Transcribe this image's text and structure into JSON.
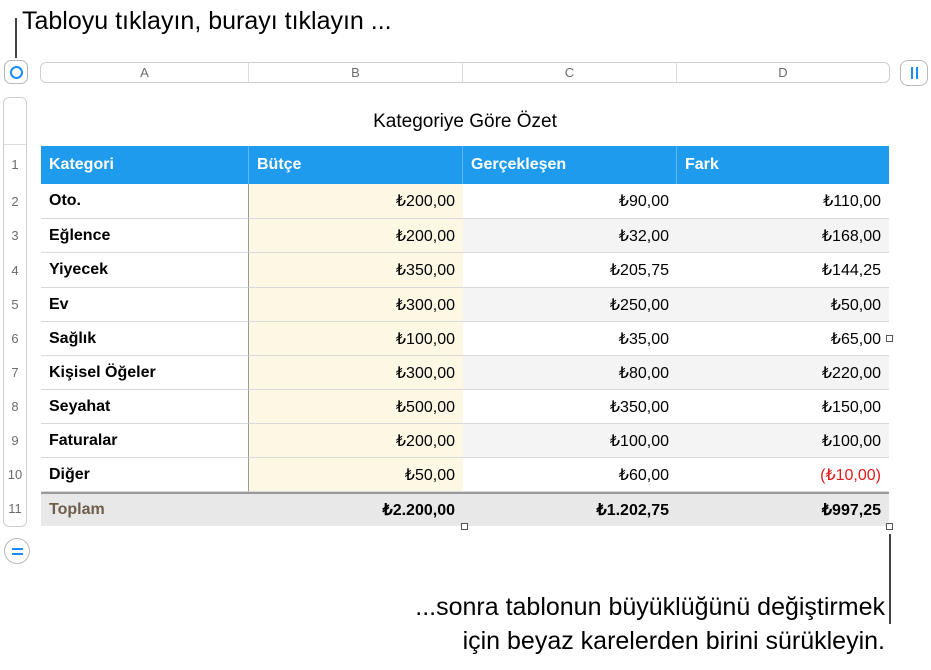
{
  "callouts": {
    "top": "Tabloyu tıklayın, burayı tıklayın ...",
    "bottom_line1": "...sonra tablonun büyüklüğünü değiştirmek",
    "bottom_line2": "için beyaz karelerden birini sürükleyin."
  },
  "column_letters": [
    "A",
    "B",
    "C",
    "D"
  ],
  "row_numbers": [
    "1",
    "2",
    "3",
    "4",
    "5",
    "6",
    "7",
    "8",
    "9",
    "10",
    "11"
  ],
  "table": {
    "title": "Kategoriye Göre Özet",
    "headers": [
      "Kategori",
      "Bütçe",
      "Gerçekleşen",
      "Fark"
    ],
    "rows": [
      [
        "Oto.",
        "₺200,00",
        "₺90,00",
        "₺110,00"
      ],
      [
        "Eğlence",
        "₺200,00",
        "₺32,00",
        "₺168,00"
      ],
      [
        "Yiyecek",
        "₺350,00",
        "₺205,75",
        "₺144,25"
      ],
      [
        "Ev",
        "₺300,00",
        "₺250,00",
        "₺50,00"
      ],
      [
        "Sağlık",
        "₺100,00",
        "₺35,00",
        "₺65,00"
      ],
      [
        "Kişisel Öğeler",
        "₺300,00",
        "₺80,00",
        "₺220,00"
      ],
      [
        "Seyahat",
        "₺500,00",
        "₺350,00",
        "₺150,00"
      ],
      [
        "Faturalar",
        "₺200,00",
        "₺100,00",
        "₺100,00"
      ],
      [
        "Diğer",
        "₺50,00",
        "₺60,00",
        "(₺10,00)"
      ]
    ],
    "footer": [
      "Toplam",
      "₺2.200,00",
      "₺1.202,75",
      "₺997,25"
    ]
  },
  "icons": {
    "select_table": "circle-select-icon",
    "add_column": "column-handle-icon",
    "add_row": "row-handle-icon"
  },
  "colors": {
    "header_bg": "#1f9bed",
    "accent": "#1a8cff",
    "budget_bg": "#fdf8e4",
    "negative": "#e01b1b"
  }
}
